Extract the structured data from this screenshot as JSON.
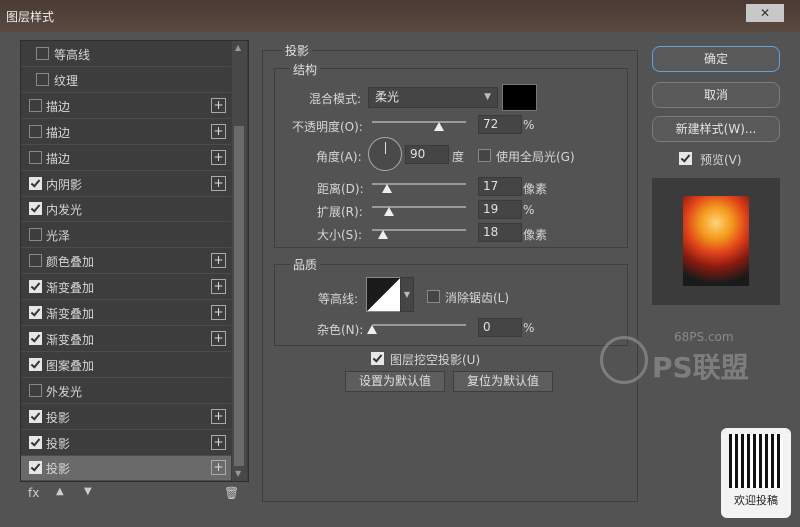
{
  "window": {
    "title": "图层样式",
    "close_glyph": "✕"
  },
  "styles_list": {
    "items": [
      {
        "label": "等高线",
        "checked": false,
        "indent": true,
        "has_add": false,
        "selected": false
      },
      {
        "label": "纹理",
        "checked": false,
        "indent": true,
        "has_add": false,
        "selected": false
      },
      {
        "label": "描边",
        "checked": false,
        "indent": false,
        "has_add": true,
        "selected": false
      },
      {
        "label": "描边",
        "checked": false,
        "indent": false,
        "has_add": true,
        "selected": false
      },
      {
        "label": "描边",
        "checked": false,
        "indent": false,
        "has_add": true,
        "selected": false
      },
      {
        "label": "内阴影",
        "checked": true,
        "indent": false,
        "has_add": true,
        "selected": false
      },
      {
        "label": "内发光",
        "checked": true,
        "indent": false,
        "has_add": false,
        "selected": false
      },
      {
        "label": "光泽",
        "checked": false,
        "indent": false,
        "has_add": false,
        "selected": false
      },
      {
        "label": "颜色叠加",
        "checked": false,
        "indent": false,
        "has_add": true,
        "selected": false
      },
      {
        "label": "渐变叠加",
        "checked": true,
        "indent": false,
        "has_add": true,
        "selected": false
      },
      {
        "label": "渐变叠加",
        "checked": true,
        "indent": false,
        "has_add": true,
        "selected": false
      },
      {
        "label": "渐变叠加",
        "checked": true,
        "indent": false,
        "has_add": true,
        "selected": false
      },
      {
        "label": "图案叠加",
        "checked": true,
        "indent": false,
        "has_add": false,
        "selected": false
      },
      {
        "label": "外发光",
        "checked": false,
        "indent": false,
        "has_add": false,
        "selected": false
      },
      {
        "label": "投影",
        "checked": true,
        "indent": false,
        "has_add": true,
        "selected": false
      },
      {
        "label": "投影",
        "checked": true,
        "indent": false,
        "has_add": true,
        "selected": false
      },
      {
        "label": "投影",
        "checked": true,
        "indent": false,
        "has_add": true,
        "selected": true
      }
    ],
    "add_glyph": "+",
    "tools": {
      "fx": "fx",
      "up": "▲",
      "down": "▼",
      "trash": "🗑"
    }
  },
  "shadow_panel": {
    "title": "投影",
    "structure": {
      "legend": "结构",
      "blend_mode_label": "混合模式:",
      "blend_mode_value": "柔光",
      "shadow_color": "#000000",
      "opacity_label": "不透明度(O):",
      "opacity_value": "72",
      "opacity_unit": "%",
      "angle_label": "角度(A):",
      "angle_value": "90",
      "angle_unit": "度",
      "global_light_label": "使用全局光(G)",
      "global_light_checked": false,
      "distance_label": "距离(D):",
      "distance_value": "17",
      "distance_unit": "像素",
      "spread_label": "扩展(R):",
      "spread_value": "19",
      "spread_unit": "%",
      "size_label": "大小(S):",
      "size_value": "18",
      "size_unit": "像素"
    },
    "quality": {
      "legend": "品质",
      "contour_label": "等高线:",
      "anti_alias_label": "消除锯齿(L)",
      "anti_alias_checked": false,
      "noise_label": "杂色(N):",
      "noise_value": "0",
      "noise_unit": "%"
    },
    "knockout_label": "图层挖空投影(U)",
    "knockout_checked": true,
    "make_default": "设置为默认值",
    "reset_default": "复位为默认值"
  },
  "buttons": {
    "ok": "确定",
    "cancel": "取消",
    "new_style": "新建样式(W)...",
    "preview_label": "预览(V)",
    "preview_checked": true
  },
  "watermark": {
    "site": "68PS.com",
    "brand": "PS联盟"
  },
  "qr": {
    "caption": "欢迎投稿"
  }
}
